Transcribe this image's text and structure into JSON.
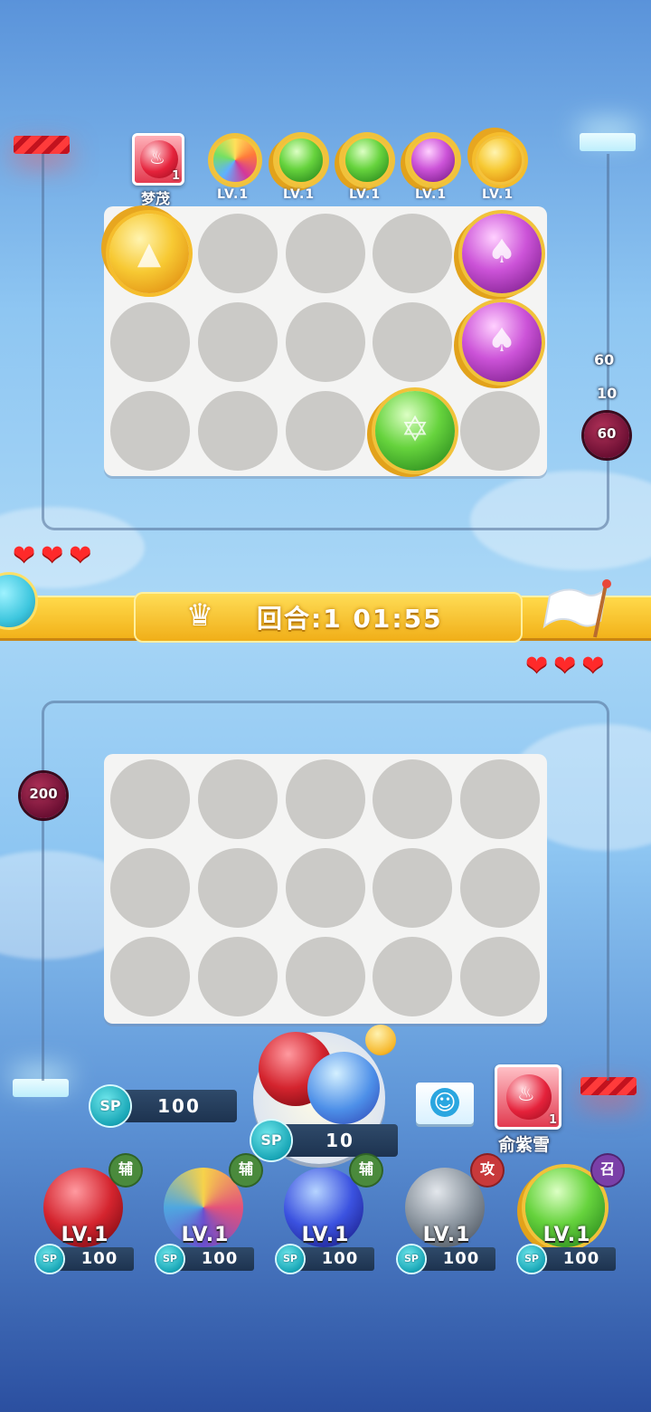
{
  "opponent": {
    "name": "梦茂",
    "avatar_level": "1",
    "hearts": "❤❤❤",
    "lineup": [
      {
        "icon": "rainbow-swirl-orb-icon",
        "level": "LV.1"
      },
      {
        "icon": "green-arrow-orb-icon",
        "level": "LV.1"
      },
      {
        "icon": "green-star-orb-icon",
        "level": "LV.1"
      },
      {
        "icon": "purple-mushroom-orb-icon",
        "level": "LV.1"
      },
      {
        "icon": "gold-triangle-orb-icon",
        "level": "LV.1"
      }
    ],
    "floating_numbers": [
      "60",
      "10",
      "60"
    ]
  },
  "round_banner": {
    "text": "回合:1  01:55"
  },
  "player": {
    "name": "俞紫雪",
    "avatar_level": "1",
    "hearts": "❤❤❤",
    "sp_total": "100",
    "sp_label": "SP",
    "summon_cost": "10",
    "monster_hp": "200",
    "units": [
      {
        "icon": "red-fang-orb-icon",
        "level": "LV.1",
        "tag": "辅",
        "cost": "100"
      },
      {
        "icon": "rainbow-wing-orb-icon",
        "level": "LV.1",
        "tag": "辅",
        "cost": "100"
      },
      {
        "icon": "blue-arrow-orb-icon",
        "level": "LV.1",
        "tag": "辅",
        "cost": "100"
      },
      {
        "icon": "gray-swirl-orb-icon",
        "level": "LV.1",
        "tag": "攻",
        "cost": "100"
      },
      {
        "icon": "green-star-orb-icon",
        "level": "LV.1",
        "tag": "召",
        "cost": "100"
      }
    ]
  },
  "colors": {
    "banner": "#f2b21a",
    "heart": "#ff2a2a",
    "sp_badge": "#18a6b6"
  }
}
